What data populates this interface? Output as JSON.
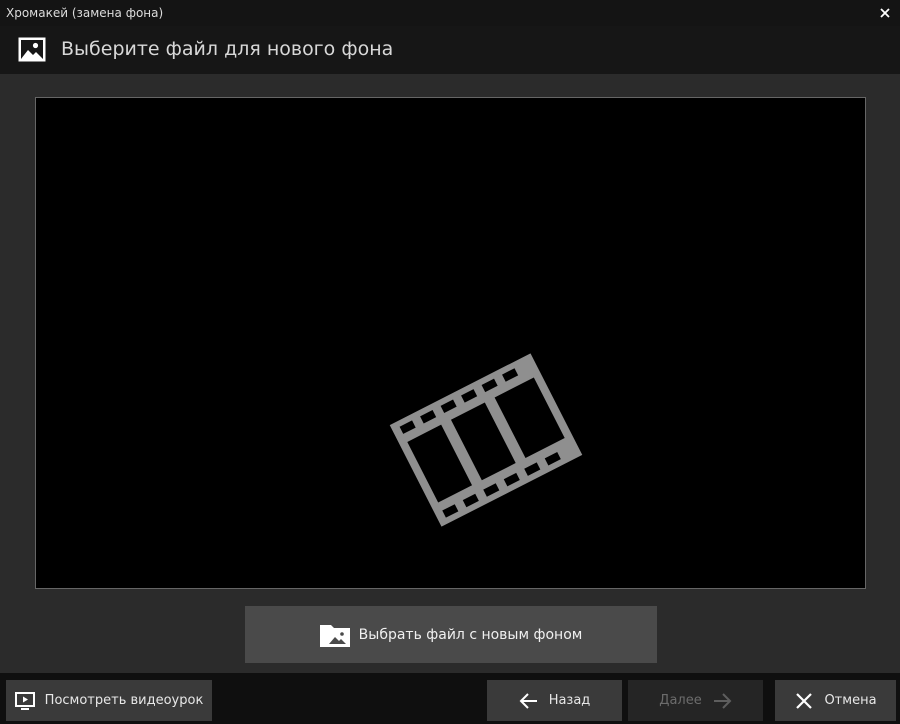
{
  "window": {
    "title": "Хромакей (замена фона)",
    "close_icon": "close-icon"
  },
  "header": {
    "icon": "image-icon",
    "title": "Выберите файл для нового фона"
  },
  "preview": {
    "placeholder_icon": "film-strip-icon"
  },
  "choose_button": {
    "icon": "folder-image-icon",
    "label": "Выбрать файл с новым фоном"
  },
  "footer": {
    "tutorial": {
      "icon": "play-video-icon",
      "label": "Посмотреть видеоурок"
    },
    "back": {
      "icon": "arrow-left-icon",
      "label": "Назад"
    },
    "next": {
      "icon": "arrow-right-icon",
      "label": "Далее",
      "disabled": true
    },
    "cancel": {
      "icon": "close-icon",
      "label": "Отмена"
    }
  },
  "colors": {
    "background": "#2b2b2b",
    "titlebar": "#141414",
    "preview": "#000000",
    "film_icon": "#8f8f8f",
    "button": "#4a4a4a"
  }
}
